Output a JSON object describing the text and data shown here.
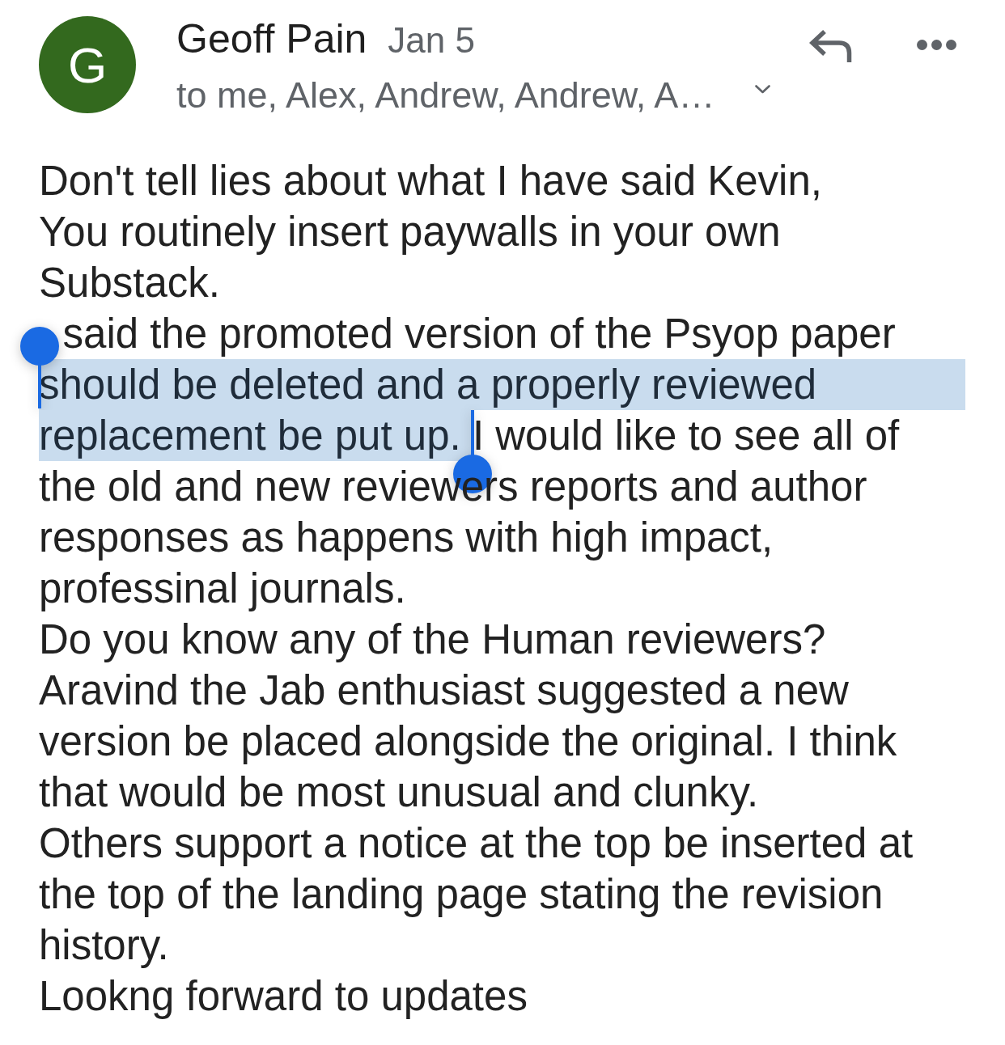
{
  "header": {
    "sender_initial": "G",
    "sender_name": "Geoff Pain",
    "date": "Jan 5",
    "recipients": "to me, Alex, Andrew, Andrew, A…"
  },
  "body": {
    "paragraphs": [
      {
        "text": "Don't tell lies about what I have said Kevin,"
      },
      {
        "text": "You routinely insert paywalls in your own Substack."
      },
      {
        "lines": [
          {
            "runs": [
              {
                "text": "said the promoted version of the Psyop paper",
                "selected": false
              }
            ]
          },
          {
            "runs": [
              {
                "text": "should be deleted and a properly reviewed",
                "selected": true
              }
            ]
          },
          {
            "runs": [
              {
                "text": "replacement be put up.",
                "selected": true
              },
              {
                "text": "I would like to see all of",
                "selected": false
              }
            ]
          },
          {
            "runs": [
              {
                "text": "the old and new reviewers reports and author",
                "selected": false
              }
            ]
          },
          {
            "runs": [
              {
                "text": "responses as happens with high impact,",
                "selected": false
              }
            ]
          },
          {
            "runs": [
              {
                "text": "professinal journals.",
                "selected": false
              }
            ]
          }
        ]
      },
      {
        "text": "Do you know any of the Human reviewers?"
      },
      {
        "text": "Aravind the Jab enthusiast suggested a new version be placed alongside the original. I think that would be most unusual and clunky."
      },
      {
        "text": "Others support a notice at the top be inserted at the top of the landing page stating the revision history."
      },
      {
        "text": "Lookng forward to updates"
      }
    ]
  }
}
